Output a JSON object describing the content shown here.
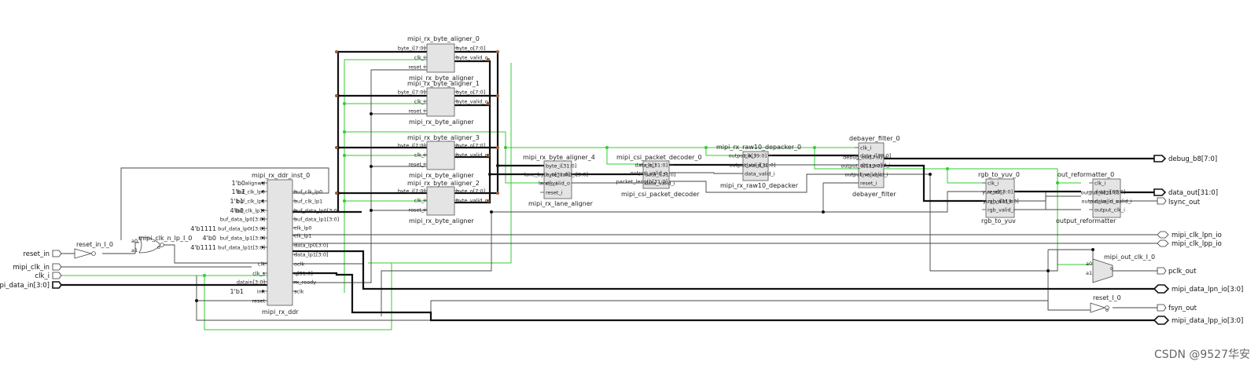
{
  "watermark": "CSDN @9527华安",
  "ports": {
    "reset_in": "reset_in",
    "mipi_clk_in": "mipi_clk_in",
    "clk_i": "clk_i",
    "mipi_data_in": "mipi_data_in[3:0]",
    "debug_b8": "debug_b8[7:0]",
    "data_out": "data_out[31:0]",
    "lsync_out": "lsync_out",
    "mipi_clk_lpn_io": "mipi_clk_lpn_io",
    "mipi_clk_lpp_io": "mipi_clk_lpp_io",
    "pclk_out": "pclk_out",
    "mipi_data_lpn_io": "mipi_data_lpn_io[3:0]",
    "fsyn_out": "fsyn_out",
    "mipi_data_lpp_io": "mipi_data_lpp_io[3:0]"
  },
  "blocks": {
    "reset_in_ibuf": {
      "name": "reset_in_I_0"
    },
    "mipi_clk_gate": {
      "name": "mipi_clk_n_lp_I_0",
      "in0": "a0",
      "in1": "a1",
      "out": "o"
    },
    "ddr": {
      "name": "mipi_rx_ddr_inst_0",
      "label": "mipi_rx_ddr",
      "in_pins": [
        "alignwd",
        "buf_clk_lp0",
        "buf_clk_lp1",
        "buf_clk_lp1t",
        "buf_data_lp0[3:0]",
        "buf_data_lp0t[3:0]",
        "buf_data_lp1[3:0]",
        "buf_data_lp1t[3:0]",
        "clk",
        "clk_s",
        "datain[3:0]",
        "init",
        "reset"
      ],
      "out_pins": [
        "buf_clk_lp0",
        "buf_clk_lp1",
        "buf_data_lp0[3:0]",
        "buf_data_lp1[3:0]",
        "clk_lp0",
        "clk_lp1",
        "data_lp0[3:0]",
        "data_lp1[3:0]",
        "oclk",
        "q[31:0]",
        "rx_ready",
        "sclk"
      ],
      "constants": [
        "1'b0",
        "1'b1",
        "1'b1",
        "4'b0",
        "4'b1111",
        "4'b0",
        "4'b1111",
        "1'b1"
      ]
    },
    "aligners": [
      {
        "name": "mipi_rx_byte_aligner_0",
        "label": "mipi_rx_byte_aligner"
      },
      {
        "name": "mipi_rx_byte_aligner_1",
        "label": "mipi_rx_byte_aligner"
      },
      {
        "name": "mipi_rx_byte_aligner_3",
        "label": "mipi_rx_byte_aligner"
      },
      {
        "name": "mipi_rx_byte_aligner_2",
        "label": "mipi_rx_byte_aligner"
      }
    ],
    "aligner_pins": {
      "in": [
        "byte_i[7:0]",
        "clk_i",
        "reset_i"
      ],
      "out": [
        "byte_o[7:0]",
        "byte_valid_o"
      ]
    },
    "lane": {
      "name": "mipi_rx_byte_aligner_4",
      "label": "mipi_rx_lane_aligner",
      "in": [
        "byte_i[31:0]",
        "byte_valid_i[3:0]",
        "clk_i",
        "reset_i"
      ],
      "out": [
        "lane_byte_o[31:0]",
        "lane_valid_o"
      ]
    },
    "csi": {
      "name": "mipi_csi_packet_decoder_0",
      "label": "mipi_csi_packet_decoder",
      "in": [
        "clk_i",
        "data_i[31:0]",
        "data_valid_i"
      ],
      "out": [
        "data_o[31:0]",
        "output_valid_o",
        "packet_length[31:0]"
      ]
    },
    "raw10": {
      "name": "mipi_rx_raw10_depacker_0",
      "label": "mipi_rx_raw10_depacker",
      "in": [
        "clk_i",
        "data_i[31:0]",
        "data_valid_i"
      ],
      "out": [
        "output_o[39:0]",
        "output_valid_o"
      ]
    },
    "debayer": {
      "name": "debayer_filter_0",
      "label": "debayer_filter",
      "in": [
        "clk_i",
        "data_i[39:0]",
        "data_valid_i",
        "line_valid_i",
        "reset_i"
      ],
      "out": [
        "debug_out[7:0]",
        "output_o[119:0]",
        "output_valid_o"
      ]
    },
    "rgb2yuv": {
      "name": "rgb_to_yuv_0",
      "label": "rgb_to_yuv",
      "in": [
        "clk_i",
        "reset_i",
        "rgb_i[119:0]",
        "rgb_valid_i"
      ],
      "out": [
        "yuv_o[63:0]",
        "yuv_valid_o"
      ]
    },
    "reformatter": {
      "name": "out_reformatter_0",
      "label": "output_reformatter",
      "in": [
        "clk_i",
        "data_i[63:0]",
        "data_in_valid_i",
        "output_clk_i"
      ],
      "out": [
        "output_o[31:0]",
        "output_valid_o"
      ]
    },
    "pclk_mux": {
      "name": "mipi_out_clk_I_0",
      "in0": "a0",
      "in1": "a1",
      "out": "o"
    },
    "fsyn_inv": {
      "name": "reset_I_0",
      "out": "o"
    }
  }
}
